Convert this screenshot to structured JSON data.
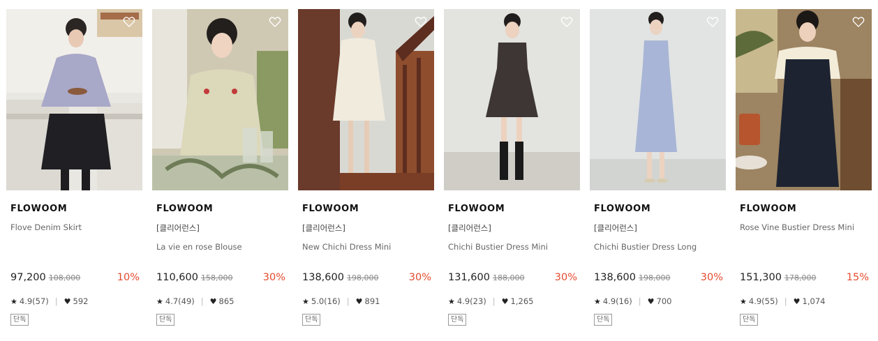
{
  "colors": {
    "discount": "#e34b2e",
    "text": "#222222",
    "muted": "#888888"
  },
  "products": [
    {
      "brand": "FLOWOOM",
      "tag": "",
      "name": "Flove Denim Skirt",
      "price": "97,200",
      "original_price": "108,000",
      "discount": "10%",
      "rating": "4.9(57)",
      "likes": "592",
      "badge": "단독",
      "heart_icon": "heart-outline"
    },
    {
      "brand": "FLOWOOM",
      "tag": "[클리어런스]",
      "name": "La vie en rose Blouse",
      "price": "110,600",
      "original_price": "158,000",
      "discount": "30%",
      "rating": "4.7(49)",
      "likes": "865",
      "badge": "단독",
      "heart_icon": "heart-outline"
    },
    {
      "brand": "FLOWOOM",
      "tag": "[클리어런스]",
      "name": "New Chichi Dress Mini",
      "price": "138,600",
      "original_price": "198,000",
      "discount": "30%",
      "rating": "5.0(16)",
      "likes": "891",
      "badge": "단독",
      "heart_icon": "heart-outline"
    },
    {
      "brand": "FLOWOOM",
      "tag": "[클리어런스]",
      "name": "Chichi Bustier Dress Mini",
      "price": "131,600",
      "original_price": "188,000",
      "discount": "30%",
      "rating": "4.9(23)",
      "likes": "1,265",
      "badge": "단독",
      "heart_icon": "heart-outline"
    },
    {
      "brand": "FLOWOOM",
      "tag": "[클리어런스]",
      "name": "Chichi Bustier Dress Long",
      "price": "138,600",
      "original_price": "198,000",
      "discount": "30%",
      "rating": "4.9(16)",
      "likes": "700",
      "badge": "단독",
      "heart_icon": "heart-outline"
    },
    {
      "brand": "FLOWOOM",
      "tag": "",
      "name": "Rose Vine Bustier Dress Mini",
      "price": "151,300",
      "original_price": "178,000",
      "discount": "15%",
      "rating": "4.9(55)",
      "likes": "1,074",
      "badge": "단독",
      "heart_icon": "heart-outline"
    }
  ]
}
